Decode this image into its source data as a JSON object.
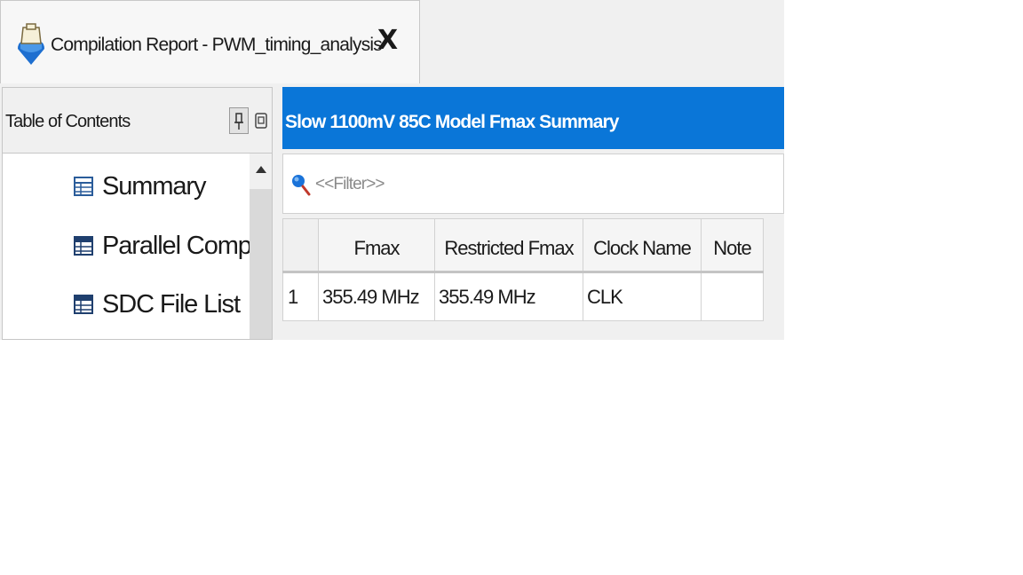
{
  "window": {
    "tab_title": "Compilation Report - PWM_timing_analysis",
    "close_glyph": "X",
    "tab_icon": "quartus-icon"
  },
  "toc": {
    "title": "Table of Contents",
    "pin_icon": "pin-icon",
    "float_icon": "float-icon",
    "items": [
      {
        "label": "Summary",
        "icon": "table-icon"
      },
      {
        "label": "Parallel Compila",
        "icon": "table-icon"
      },
      {
        "label": "SDC File List",
        "icon": "table-icon"
      }
    ]
  },
  "report": {
    "title": "Slow 1100mV 85C Model Fmax Summary",
    "filter_placeholder": "<<Filter>>",
    "columns": [
      "",
      "Fmax",
      "Restricted Fmax",
      "Clock Name",
      "Note"
    ],
    "rows": [
      {
        "num": "1",
        "fmax": "355.49 MHz",
        "restricted_fmax": "355.49 MHz",
        "clock_name": "CLK",
        "note": ""
      }
    ]
  },
  "colors": {
    "header_blue": "#0a76d8",
    "panel_gray": "#f0f0f0"
  }
}
